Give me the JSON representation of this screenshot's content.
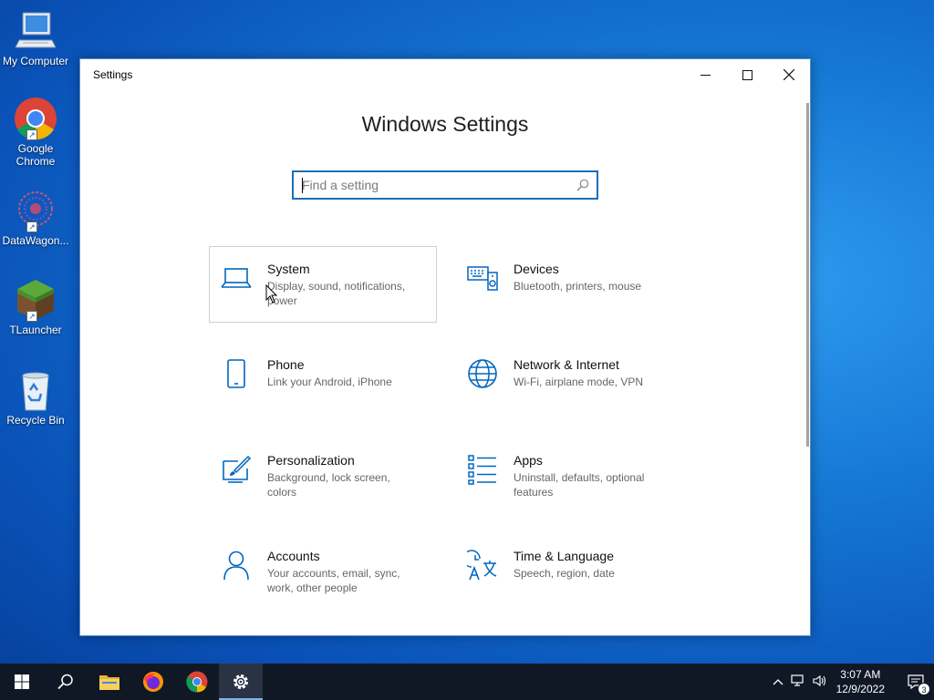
{
  "desktop": {
    "icons": [
      {
        "label": "My Computer"
      },
      {
        "label": "Google Chrome"
      },
      {
        "label": "DataWagon..."
      },
      {
        "label": "TLauncher"
      },
      {
        "label": "Recycle Bin"
      }
    ]
  },
  "window": {
    "title": "Settings",
    "heading": "Windows Settings",
    "search_placeholder": "Find a setting",
    "tiles": [
      {
        "name": "System",
        "desc": "Display, sound, notifications, power",
        "icon": "laptop-icon"
      },
      {
        "name": "Devices",
        "desc": "Bluetooth, printers, mouse",
        "icon": "keyboard-speaker-icon"
      },
      {
        "name": "Phone",
        "desc": "Link your Android, iPhone",
        "icon": "phone-icon"
      },
      {
        "name": "Network & Internet",
        "desc": "Wi-Fi, airplane mode, VPN",
        "icon": "globe-icon"
      },
      {
        "name": "Personalization",
        "desc": "Background, lock screen, colors",
        "icon": "paint-brush-icon"
      },
      {
        "name": "Apps",
        "desc": "Uninstall, defaults, optional features",
        "icon": "apps-list-icon"
      },
      {
        "name": "Accounts",
        "desc": "Your accounts, email, sync, work, other people",
        "icon": "person-icon"
      },
      {
        "name": "Time & Language",
        "desc": "Speech, region, date",
        "icon": "time-language-icon"
      }
    ]
  },
  "taskbar": {
    "time": "3:07 AM",
    "date": "12/9/2022",
    "notification_count": "3"
  },
  "colors": {
    "accent": "#0067c0",
    "taskbar": "#101826"
  }
}
